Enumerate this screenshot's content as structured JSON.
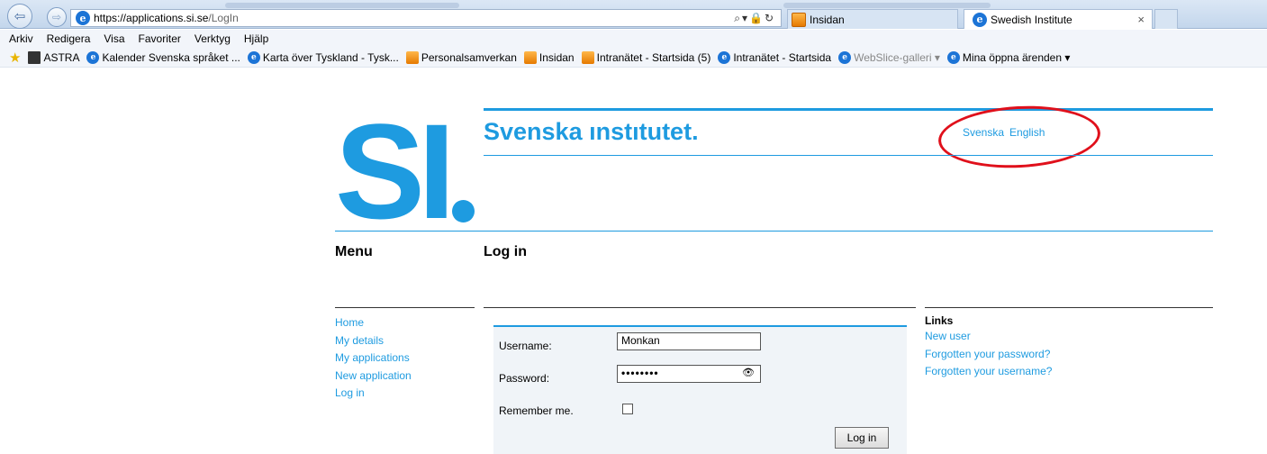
{
  "browser": {
    "url_host": "https://applications.si.se",
    "url_path": "/LogIn",
    "tabs": [
      {
        "label": "Insidan"
      },
      {
        "label": "Swedish Institute"
      }
    ],
    "menu": [
      "Arkiv",
      "Redigera",
      "Visa",
      "Favoriter",
      "Verktyg",
      "Hjälp"
    ],
    "favorites": [
      {
        "label": "ASTRA",
        "icon": "book-icon"
      },
      {
        "label": "Kalender Svenska språket ...",
        "icon": "ie-icon"
      },
      {
        "label": "Karta över Tyskland - Tysk...",
        "icon": "ie-icon"
      },
      {
        "label": "Personalsamverkan",
        "icon": "favorite-icon"
      },
      {
        "label": "Insidan",
        "icon": "favorite-icon"
      },
      {
        "label": "Intranätet - Startsida (5)",
        "icon": "favorite-icon"
      },
      {
        "label": "Intranätet - Startsida",
        "icon": "ie-icon"
      },
      {
        "label": "WebSlice-galleri ▾",
        "icon": "ie-icon"
      },
      {
        "label": "Mina öppna ärenden ▾",
        "icon": "ie-icon"
      }
    ]
  },
  "site": {
    "logo_text": "SI",
    "brand": "Svenska ınstıtutet.",
    "languages": [
      "Svenska",
      "English"
    ],
    "accent_color": "#1e9be0",
    "highlight_color": "#e0101b"
  },
  "menu": {
    "title": "Menu",
    "items": [
      "Home",
      "My details",
      "My applications",
      "New application",
      "Log in"
    ]
  },
  "login": {
    "title": "Log in",
    "username_label": "Username:",
    "username_value": "Monkan",
    "password_label": "Password:",
    "password_value": "••••••••",
    "remember_label": "Remember me.",
    "remember_checked": false,
    "submit_label": "Log in"
  },
  "links": {
    "title": "Links",
    "items": [
      "New user",
      "Forgotten your password?",
      "Forgotten your username?"
    ]
  }
}
